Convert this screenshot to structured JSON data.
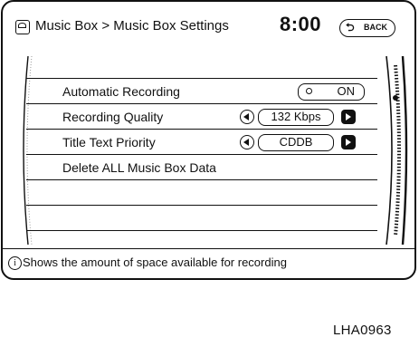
{
  "header": {
    "title": "Music Box > Music Box Settings",
    "clock": "8:00",
    "back_label": "BACK"
  },
  "settings": {
    "rows": [
      {
        "label": "Automatic Recording",
        "value": "ON",
        "control": "toggle"
      },
      {
        "label": "Recording Quality",
        "value": "132 Kbps",
        "control": "stepper"
      },
      {
        "label": "Title Text Priority",
        "value": "CDDB",
        "control": "stepper"
      },
      {
        "label": "Delete ALL Music Box Data",
        "value": "",
        "control": "action"
      }
    ]
  },
  "hint": {
    "text": "Shows the amount of space available for recording",
    "icon": "info-icon"
  },
  "figure_code": "LHA0963"
}
